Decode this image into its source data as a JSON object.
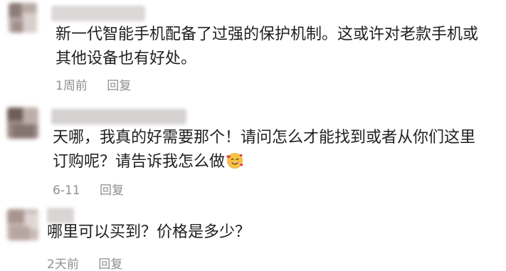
{
  "comments": [
    {
      "text_lines": [
        "新一代智能手机配备了过强的保护机制。这或许对老款手机或",
        "其他设备也有好处。"
      ],
      "time": "1周前",
      "reply_label": "回复"
    },
    {
      "text_lines": [
        "天哪，我真的好需要那个！请问怎么才能找到或者从你们这里",
        "订购呢？请告诉我怎么做"
      ],
      "emoji": "smiling-face-with-hearts-icon",
      "time": "6-11",
      "reply_label": "回复"
    },
    {
      "text_lines": [
        "哪里可以买到？价格是多少？"
      ],
      "time": "2天前",
      "reply_label": "回复"
    }
  ],
  "colors": {
    "text": "#1f1f1f",
    "meta": "#8f8f8f",
    "avatar_1": "#b9a9a6",
    "avatar_2": "#9c8b85",
    "avatar_3": "#c9bbb8",
    "username_blur": "#d8d4d4"
  }
}
